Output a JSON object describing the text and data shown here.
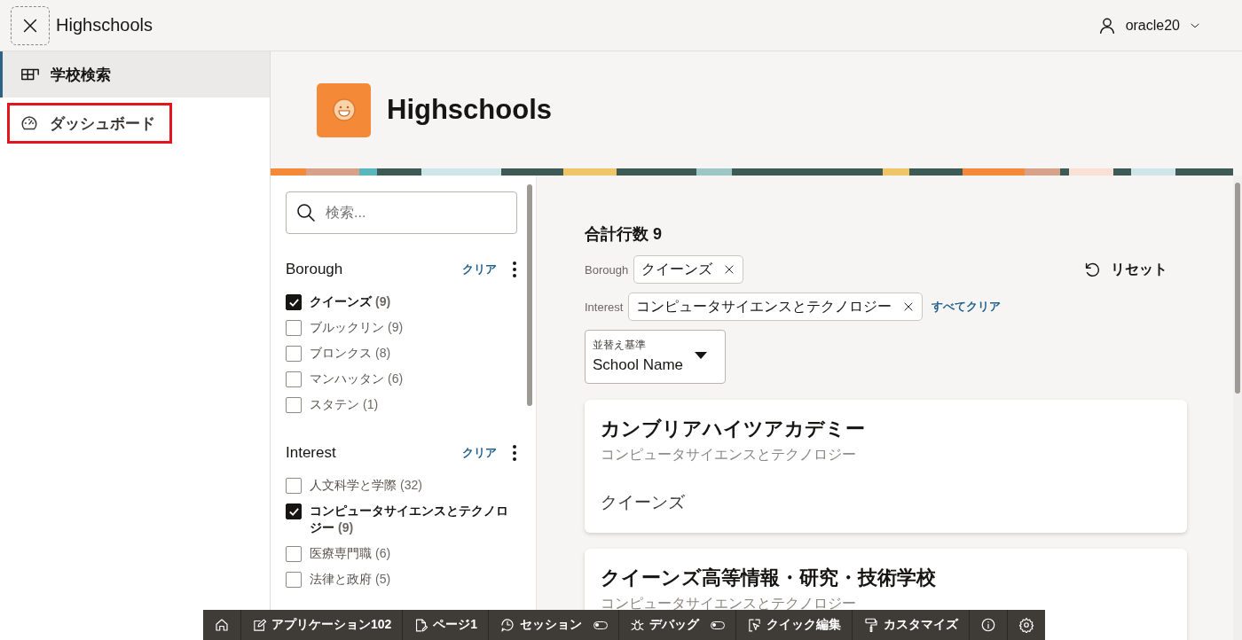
{
  "header": {
    "title": "Highschools",
    "user": "oracle20"
  },
  "nav": [
    {
      "label": "学校検索",
      "kind": "grid",
      "selected": true,
      "highlighted": false
    },
    {
      "label": "ダッシュボード",
      "kind": "gauge",
      "selected": false,
      "highlighted": true
    }
  ],
  "hero": {
    "title": "Highschools"
  },
  "search": {
    "placeholder": "検索..."
  },
  "facets": [
    {
      "title": "Borough",
      "clear": "クリア",
      "options": [
        {
          "label": "クイーンズ",
          "count": "(9)",
          "checked": true
        },
        {
          "label": "ブルックリン",
          "count": "(9)",
          "checked": false
        },
        {
          "label": "ブロンクス",
          "count": "(8)",
          "checked": false
        },
        {
          "label": "マンハッタン",
          "count": "(6)",
          "checked": false
        },
        {
          "label": "スタテン",
          "count": "(1)",
          "checked": false
        }
      ]
    },
    {
      "title": "Interest",
      "clear": "クリア",
      "options": [
        {
          "label": "人文科学と学際",
          "count": "(32)",
          "checked": false
        },
        {
          "label": "コンピュータサイエンスとテクノロジー",
          "count": "(9)",
          "checked": true
        },
        {
          "label": "医療専門職",
          "count": "(6)",
          "checked": false
        },
        {
          "label": "法律と政府",
          "count": "(5)",
          "checked": false
        }
      ]
    }
  ],
  "results": {
    "total": "合計行数 9",
    "reset": "リセット",
    "clear_all": "すべてクリア",
    "chips": [
      {
        "group": "Borough",
        "value": "クイーンズ"
      },
      {
        "group": "Interest",
        "value": "コンピュータサイエンスとテクノロジー"
      }
    ],
    "sort": {
      "label": "並替え基準",
      "value": "School Name"
    },
    "cards": [
      {
        "name": "カンブリアハイツアカデミー",
        "interest": "コンピュータサイエンスとテクノロジー",
        "borough": "クイーンズ"
      },
      {
        "name": "クイーンズ高等情報・研究・技術学校",
        "interest": "コンピュータサイエンスとテクノロジー"
      }
    ]
  },
  "dev_toolbar": [
    {
      "kind": "home"
    },
    {
      "kind": "application",
      "label": "アプリケーション102"
    },
    {
      "kind": "page",
      "label": "ページ1"
    },
    {
      "kind": "session",
      "label": "セッション",
      "on": false
    },
    {
      "kind": "debug",
      "label": "デバッグ",
      "on": false
    },
    {
      "kind": "quick_edit",
      "label": "クイック編集"
    },
    {
      "kind": "customize",
      "label": "カスタマイズ"
    },
    {
      "kind": "info"
    },
    {
      "kind": "settings"
    }
  ]
}
